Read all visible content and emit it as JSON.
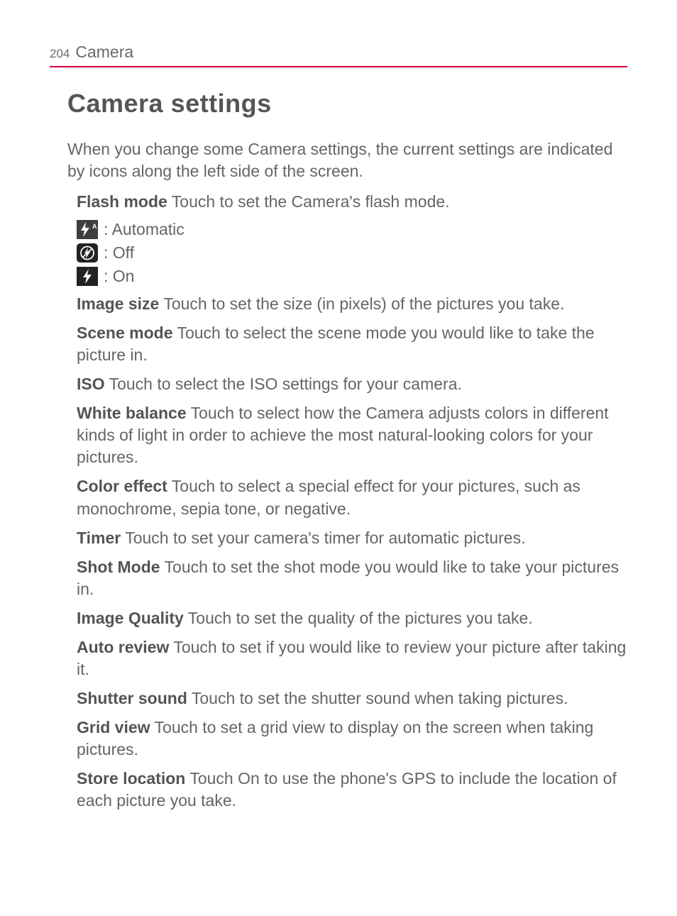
{
  "header": {
    "page_number": "204",
    "chapter": "Camera"
  },
  "section_title": "Camera settings",
  "intro": "When you change some Camera settings, the current settings are indicated by icons along the left side of the screen.",
  "flash": {
    "label": "Flash mode",
    "text": " Touch to set the Camera's flash mode.",
    "modes": {
      "auto": " : Automatic",
      "off": " : Off",
      "on": " : On"
    }
  },
  "settings": {
    "image_size": {
      "label": "Image size",
      "text": " Touch to set the size (in pixels) of the pictures you take."
    },
    "scene_mode": {
      "label": "Scene mode",
      "text": " Touch to select the scene mode you would like to take the picture in."
    },
    "iso": {
      "label": "ISO",
      "text": " Touch to select the ISO settings for your camera."
    },
    "white_balance": {
      "label": "White balance",
      "text": " Touch to select how the Camera adjusts colors in different kinds of light in order to achieve the most natural-looking colors for your pictures."
    },
    "color_effect": {
      "label": "Color effect",
      "text": " Touch to select a special effect for your pictures, such as monochrome, sepia tone, or negative."
    },
    "timer": {
      "label": "Timer",
      "text": " Touch to set your camera's timer for automatic pictures."
    },
    "shot_mode": {
      "label": "Shot Mode",
      "text": " Touch to set the shot mode you would like to take your pictures in."
    },
    "image_quality": {
      "label": "Image Quality",
      "text": " Touch to set the quality of the pictures you take."
    },
    "auto_review": {
      "label": "Auto review",
      "text": " Touch to set if you would like to review your picture after taking it."
    },
    "shutter_sound": {
      "label": "Shutter sound",
      "text": " Touch to set the shutter sound when taking pictures."
    },
    "grid_view": {
      "label": "Grid view",
      "text": " Touch to set a grid view to display on the screen when taking pictures."
    },
    "store_location": {
      "label": "Store location",
      "text": " Touch On to use the phone's GPS to include the location of each picture you take."
    }
  }
}
